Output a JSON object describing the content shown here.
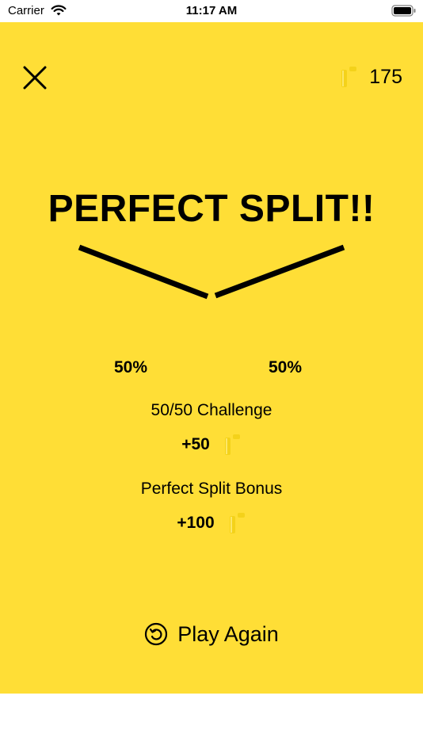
{
  "status_bar": {
    "carrier": "Carrier",
    "time": "11:17 AM"
  },
  "header": {
    "close_icon": "close-icon",
    "coin_icon": "coin-icon",
    "coin_count": "175"
  },
  "result": {
    "title": "PERFECT SPLIT!!",
    "left_percent": "50%",
    "right_percent": "50%"
  },
  "rewards": [
    {
      "label": "50/50 Challenge",
      "value": "+50"
    },
    {
      "label": "Perfect Split Bonus",
      "value": "+100"
    }
  ],
  "actions": {
    "play_again_label": "Play Again",
    "play_again_icon": "replay-icon"
  },
  "colors": {
    "background": "#FFDE36",
    "coin": "#F4D21A",
    "text": "#000000"
  }
}
